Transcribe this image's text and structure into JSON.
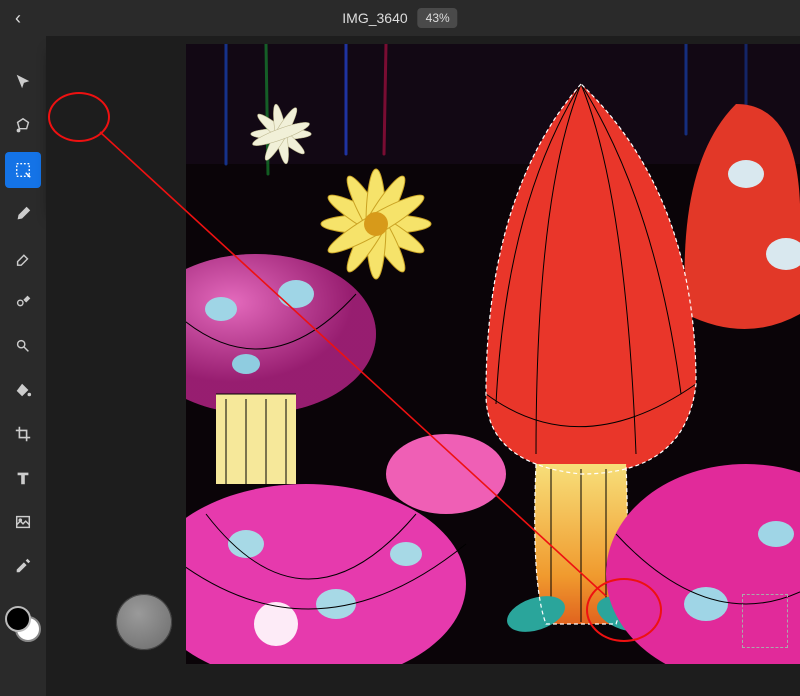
{
  "header": {
    "back_glyph": "‹",
    "title": "IMG_3640",
    "zoom": "43%"
  },
  "toolbar": {
    "tools": [
      {
        "name": "move-tool"
      },
      {
        "name": "lasso-tool"
      },
      {
        "name": "marquee-tool"
      },
      {
        "name": "brush-tool"
      },
      {
        "name": "eraser-tool"
      },
      {
        "name": "clone-stamp-tool"
      },
      {
        "name": "dodge-tool"
      },
      {
        "name": "fill-tool"
      },
      {
        "name": "crop-tool"
      },
      {
        "name": "type-tool"
      },
      {
        "name": "place-image-tool"
      },
      {
        "name": "eyedropper-tool"
      }
    ],
    "active_tool_index": 2,
    "foreground_color": "#000000",
    "background_color": "#ffffff"
  },
  "selection_modes": {
    "items": [
      {
        "name": "selection-new"
      },
      {
        "name": "selection-add"
      },
      {
        "name": "selection-subtract"
      },
      {
        "name": "selection-intersect"
      }
    ],
    "highlighted_index": 1
  },
  "canvas": {
    "annotation": {
      "ellipse_1": "selection-add mode button",
      "ellipse_2": "added rectangular selection on mushroom stem",
      "line": "connects mode button to new selection region"
    }
  }
}
